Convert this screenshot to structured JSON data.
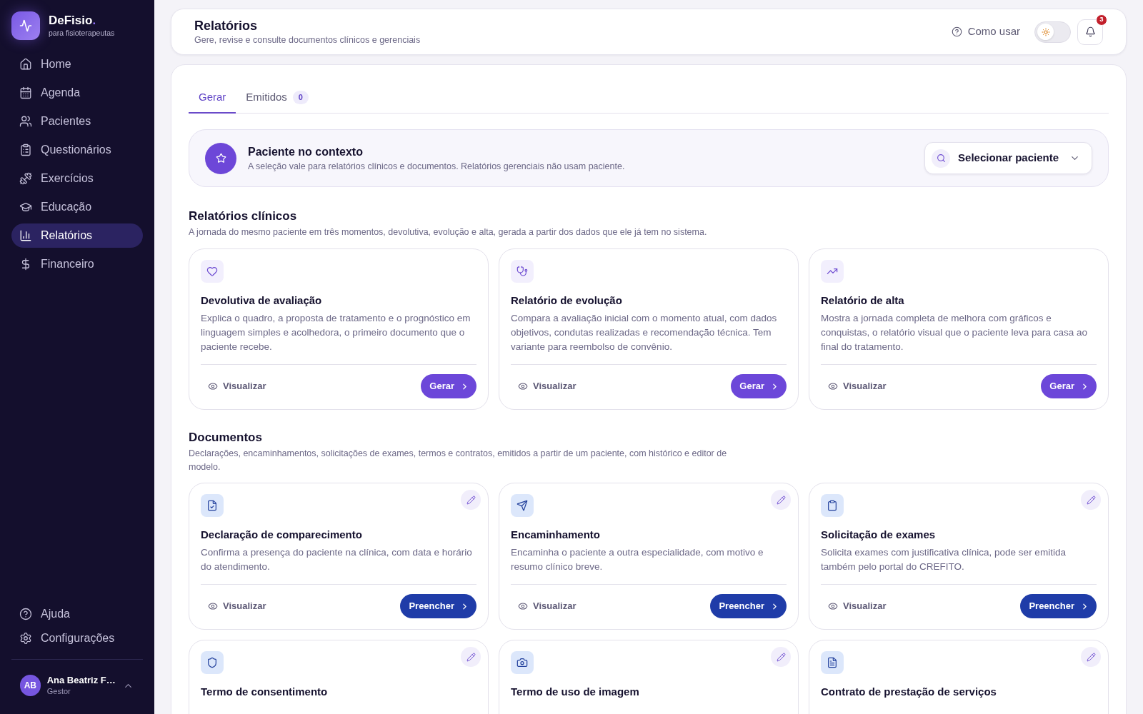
{
  "sidebar": {
    "brand": {
      "name": "DeFisio",
      "accent": ".",
      "tagline": "para fisioterapeutas"
    },
    "items": [
      {
        "label": "Home",
        "selected": false
      },
      {
        "label": "Agenda",
        "selected": false
      },
      {
        "label": "Pacientes",
        "selected": false
      },
      {
        "label": "Questionários",
        "selected": false
      },
      {
        "label": "Exercícios",
        "selected": false
      },
      {
        "label": "Educação",
        "selected": false
      },
      {
        "label": "Relatórios",
        "selected": true
      },
      {
        "label": "Financeiro",
        "selected": false
      }
    ],
    "footer_items": [
      {
        "label": "Ajuda"
      },
      {
        "label": "Configurações"
      }
    ],
    "user": {
      "initials": "AB",
      "name": "Ana Beatriz F…",
      "role": "Gestor"
    }
  },
  "header": {
    "title": "Relatórios",
    "subtitle": "Gere, revise e consulte documentos clínicos e gerenciais",
    "help_link": "Como usar",
    "theme_toggle": {
      "dark": false
    },
    "notifications": {
      "count": "3"
    }
  },
  "tabs": [
    {
      "label": "Gerar",
      "selected": true
    },
    {
      "label": "Emitidos",
      "count": "0",
      "selected": false
    }
  ],
  "patient_context": {
    "title": "Paciente no contexto",
    "description": "A seleção vale para relatórios clínicos e documentos. Relatórios gerenciais não usam paciente.",
    "select": {
      "label": "Selecionar paciente"
    }
  },
  "sections": [
    {
      "kind": "clinical",
      "title": "Relatórios clínicos",
      "description": "A jornada do mesmo paciente em três momentos, devolutiva, evolução e alta, gerada a partir dos dados que ele já tem no sistema.",
      "cards": [
        {
          "title": "Devolutiva de avaliação",
          "description": "Explica o quadro, a proposta de tratamento e o prognóstico em linguagem simples e acolhedora, o primeiro documento que o paciente recebe.",
          "editable": false,
          "view_label": "Visualizar",
          "action_label": "Gerar"
        },
        {
          "title": "Relatório de evolução",
          "description": "Compara a avaliação inicial com o momento atual, com dados objetivos, condutas realizadas e recomendação técnica. Tem variante para reembolso de convênio.",
          "editable": false,
          "view_label": "Visualizar",
          "action_label": "Gerar"
        },
        {
          "title": "Relatório de alta",
          "description": "Mostra a jornada completa de melhora com gráficos e conquistas, o relatório visual que o paciente leva para casa ao final do tratamento.",
          "editable": false,
          "view_label": "Visualizar",
          "action_label": "Gerar"
        }
      ]
    },
    {
      "kind": "documents",
      "title": "Documentos",
      "description": "Declarações, encaminhamentos, solicitações de exames, termos e contratos, emitidos a partir de um paciente, com histórico e editor de modelo.",
      "cards": [
        {
          "title": "Declaração de comparecimento",
          "description": "Confirma a presença do paciente na clínica, com data e horário do atendimento.",
          "editable": true,
          "view_label": "Visualizar",
          "action_label": "Preencher"
        },
        {
          "title": "Encaminhamento",
          "description": "Encaminha o paciente a outra especialidade, com motivo e resumo clínico breve.",
          "editable": true,
          "view_label": "Visualizar",
          "action_label": "Preencher"
        },
        {
          "title": "Solicitação de exames",
          "description": "Solicita exames com justificativa clínica, pode ser emitida também pelo portal do CREFITO.",
          "editable": true,
          "view_label": "Visualizar",
          "action_label": "Preencher"
        },
        {
          "title": "Termo de consentimento",
          "editable": true
        },
        {
          "title": "Termo de uso de imagem",
          "editable": true
        },
        {
          "title": "Contrato de prestação de serviços",
          "editable": true
        }
      ]
    }
  ]
}
